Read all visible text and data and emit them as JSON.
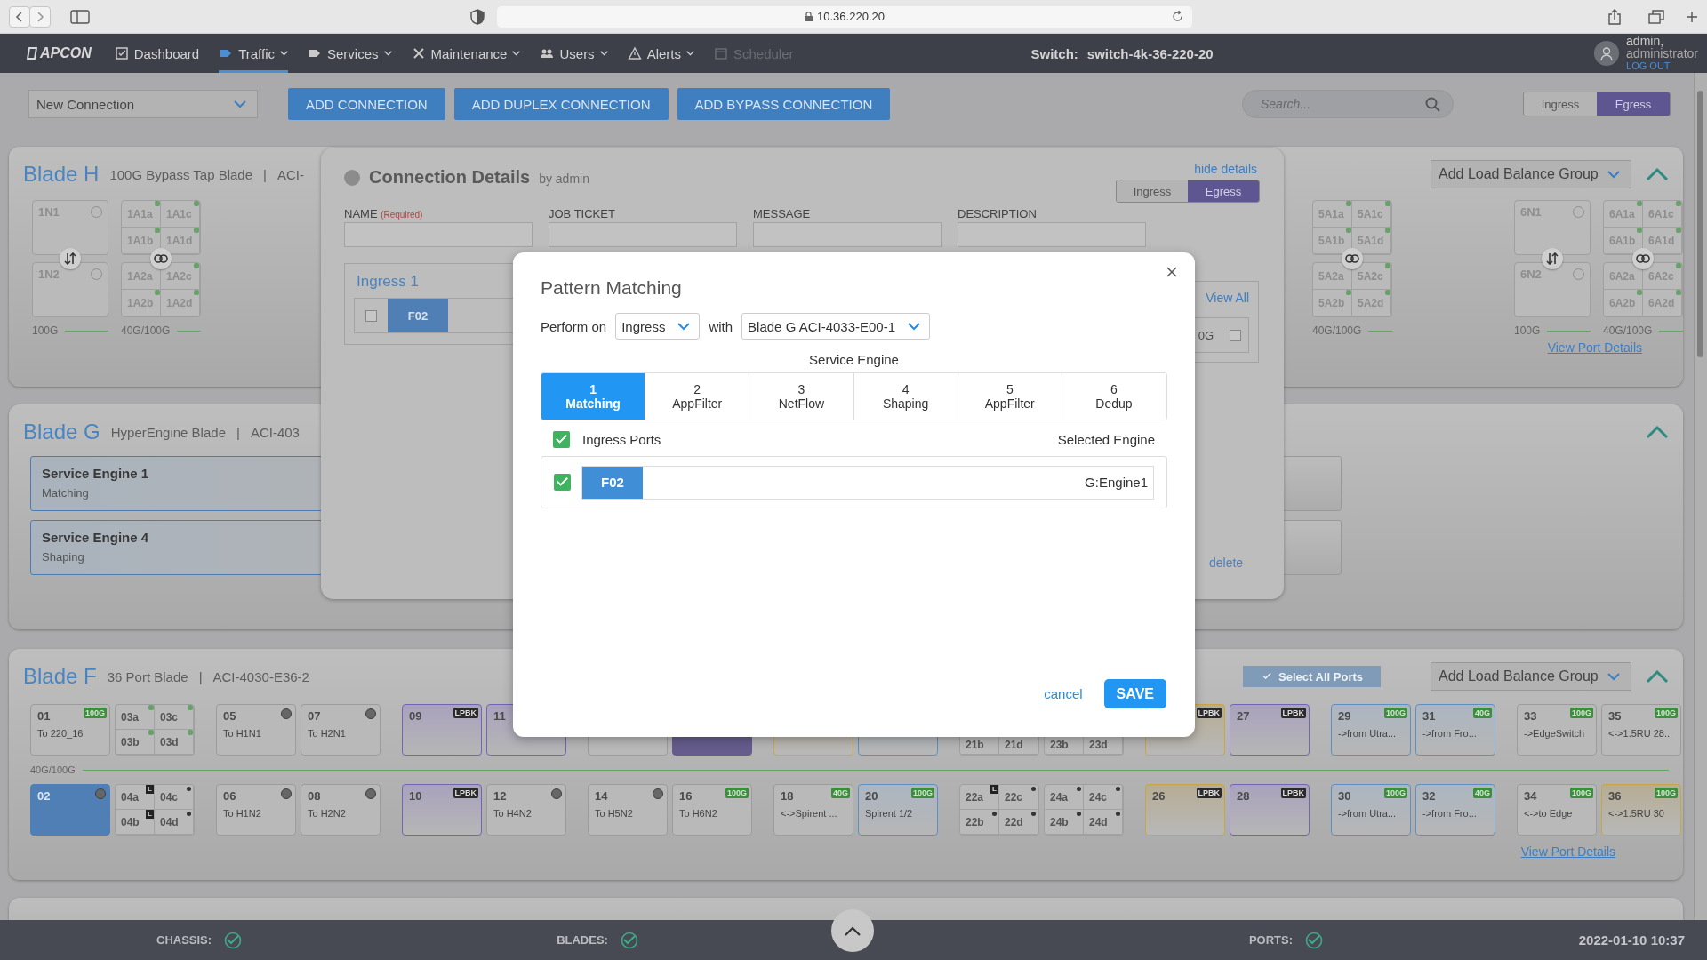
{
  "browser": {
    "url": "10.36.220.20"
  },
  "nav": {
    "logo": "APCON",
    "items": [
      {
        "label": "Dashboard",
        "selected": false,
        "disabled": false,
        "dropdown": false
      },
      {
        "label": "Traffic",
        "selected": true,
        "disabled": false,
        "dropdown": true
      },
      {
        "label": "Services",
        "selected": false,
        "disabled": false,
        "dropdown": true
      },
      {
        "label": "Maintenance",
        "selected": false,
        "disabled": false,
        "dropdown": true
      },
      {
        "label": "Users",
        "selected": false,
        "disabled": false,
        "dropdown": true
      },
      {
        "label": "Alerts",
        "selected": false,
        "disabled": false,
        "dropdown": true
      },
      {
        "label": "Scheduler",
        "selected": false,
        "disabled": true,
        "dropdown": false
      }
    ],
    "switch_label": "Switch:",
    "switch_name": "switch-4k-36-220-20",
    "user": {
      "name": "admin,",
      "role": "administrator",
      "logout": "LOG OUT"
    }
  },
  "toolbar": {
    "connection_select": "New Connection",
    "buttons": [
      "ADD CONNECTION",
      "ADD DUPLEX CONNECTION",
      "ADD BYPASS CONNECTION"
    ],
    "search": {
      "placeholder": "Search..."
    },
    "direction": [
      {
        "label": "Ingress",
        "selected": false
      },
      {
        "label": "Egress",
        "selected": true
      }
    ]
  },
  "blades": [
    {
      "kind": "tap",
      "title": "Blade H",
      "subtitle": "100G Bypass Tap Blade",
      "separator": "|",
      "model": "ACI-",
      "load_balance": "Add Load Balance Group",
      "expanded": true,
      "left_groups": [
        {
          "kind": "pair",
          "speed": "100G",
          "ports": [
            {
              "name": "1N1"
            },
            {
              "name": "1N2"
            }
          ]
        },
        {
          "kind": "quadstack",
          "speed": "40G/100G",
          "quads": [
            [
              {
                "name": "1A1a",
                "kind": "active"
              },
              {
                "name": "1A1c",
                "kind": "active"
              },
              {
                "name": "1A1b",
                "kind": "active"
              },
              {
                "name": "1A1d",
                "kind": "active"
              }
            ],
            [
              {
                "name": "1A2a",
                "kind": "active"
              },
              {
                "name": "1A2c",
                "kind": "active"
              },
              {
                "name": "1A2b",
                "kind": "active"
              },
              {
                "name": "1A2d",
                "kind": "active"
              }
            ]
          ]
        }
      ],
      "right_groups": [
        {
          "kind": "quadstack",
          "speed": "40G/100G",
          "quads": [
            [
              {
                "name": "5A1a",
                "kind": "active"
              },
              {
                "name": "5A1c",
                "kind": "active"
              },
              {
                "name": "5A1b",
                "kind": "active"
              },
              {
                "name": "5A1d",
                "kind": "active"
              }
            ],
            [
              {
                "name": "5A2a",
                "kind": "active"
              },
              {
                "name": "5A2c",
                "kind": "active"
              },
              {
                "name": "5A2b",
                "kind": "active"
              },
              {
                "name": "5A2d",
                "kind": "active"
              }
            ]
          ]
        },
        {
          "kind": "pair",
          "speed": "100G",
          "ports": [
            {
              "name": "6N1"
            },
            {
              "name": "6N2"
            }
          ]
        },
        {
          "kind": "quadstack",
          "speed": "40G/100G",
          "quads": [
            [
              {
                "name": "6A1a",
                "kind": "active"
              },
              {
                "name": "6A1c",
                "kind": "active"
              },
              {
                "name": "6A1b",
                "kind": "active"
              },
              {
                "name": "6A1d",
                "kind": "active"
              }
            ],
            [
              {
                "name": "6A2a",
                "kind": "active"
              },
              {
                "name": "6A2c",
                "kind": "active"
              },
              {
                "name": "6A2b",
                "kind": "active"
              },
              {
                "name": "6A2d",
                "kind": "active"
              }
            ]
          ]
        }
      ],
      "link": "View Port Details"
    },
    {
      "kind": "engines",
      "title": "Blade G",
      "subtitle": "HyperEngine Blade",
      "separator": "|",
      "model": "ACI-403",
      "expanded": true,
      "engines": [
        {
          "name": "Service Engine 1",
          "function": "Matching"
        },
        {
          "name": "Service Engine 4",
          "function": "Shaping"
        }
      ]
    },
    {
      "kind": "ports",
      "title": "Blade F",
      "subtitle": "36 Port Blade",
      "separator": "|",
      "model": "ACI-4030-E36-2",
      "select_all": "Select All Ports",
      "load_balance": "Add Load Balance Group",
      "expanded": true,
      "speed": "40G/100G",
      "top_row": [
        [
          {
            "kind": "plain",
            "num": "01",
            "label": "To 220_16",
            "badge": {
              "text": "100G",
              "kind": "speed"
            },
            "led": false,
            "selected": false
          },
          {
            "kind": "quad",
            "subports": [
              {
                "name": "03a",
                "kind": "active"
              },
              {
                "name": "03c",
                "kind": "active"
              },
              {
                "name": "03b",
                "kind": "active"
              },
              {
                "name": "03d",
                "kind": "active"
              }
            ]
          }
        ],
        [
          {
            "kind": "plain",
            "num": "05",
            "label": "To H1N1",
            "led": true,
            "selected": false
          },
          {
            "kind": "plain",
            "num": "07",
            "label": "To H2N1",
            "led": true,
            "selected": false
          }
        ],
        [
          {
            "kind": "loopback",
            "num": "09",
            "badge": {
              "text": "LPBK",
              "kind": "loop"
            },
            "led": false,
            "selected": false
          },
          {
            "kind": "loopback",
            "num": "11",
            "led": false,
            "selected": false
          }
        ],
        [
          {
            "kind": "plain",
            "led": false,
            "selected": false
          },
          {
            "kind": "filled",
            "led": false,
            "selected": false
          }
        ],
        [
          {
            "kind": "warning",
            "led": false,
            "selected": false
          },
          {
            "kind": "linked",
            "led": false,
            "selected": false
          }
        ],
        [
          {
            "kind": "quad",
            "subports": [
              {
                "name": "21b",
                "kind": "plain"
              },
              {
                "name": "21d",
                "kind": "plain"
              }
            ]
          },
          {
            "kind": "quad",
            "subports": [
              {
                "name": "23b",
                "kind": "plain"
              },
              {
                "name": "23d",
                "kind": "plain"
              }
            ]
          }
        ],
        [
          {
            "kind": "warning",
            "badge": {
              "text": "LPBK",
              "kind": "loop"
            },
            "led": false,
            "selected": false
          },
          {
            "kind": "loopback",
            "num": "27",
            "badge": {
              "text": "LPBK",
              "kind": "loop"
            },
            "led": false,
            "selected": false
          }
        ],
        [
          {
            "kind": "linked",
            "num": "29",
            "label": "->from Utra...",
            "badge": {
              "text": "100G",
              "kind": "speed"
            },
            "led": false,
            "selected": false
          },
          {
            "kind": "linked",
            "num": "31",
            "label": "->from Fro...",
            "badge": {
              "text": "40G",
              "kind": "speed"
            },
            "led": false,
            "selected": false
          }
        ],
        [
          {
            "kind": "plain",
            "num": "33",
            "label": "->EdgeSwitch",
            "badge": {
              "text": "100G",
              "kind": "speed"
            },
            "led": false,
            "selected": false
          },
          {
            "kind": "plain",
            "num": "35",
            "label": "<->1.5RU 28...",
            "badge": {
              "text": "100G",
              "kind": "speed"
            },
            "led": false,
            "selected": false
          }
        ]
      ],
      "bottom_row": [
        [
          {
            "kind": "plain",
            "num": "02",
            "led": true,
            "selected": true
          },
          {
            "kind": "quad",
            "subports": [
              {
                "name": "04a",
                "kind": "letter",
                "mark_text": "L"
              },
              {
                "name": "04c",
                "kind": "dot"
              },
              {
                "name": "04b",
                "kind": "letter",
                "mark_text": "L"
              },
              {
                "name": "04d",
                "kind": "dot"
              }
            ]
          }
        ],
        [
          {
            "kind": "plain",
            "num": "06",
            "label": "To H1N2",
            "led": true,
            "selected": false
          },
          {
            "kind": "plain",
            "num": "08",
            "label": "To H2N2",
            "led": true,
            "selected": false
          }
        ],
        [
          {
            "kind": "loopback",
            "num": "10",
            "badge": {
              "text": "LPBK",
              "kind": "loop"
            },
            "led": false,
            "selected": false
          },
          {
            "kind": "plain",
            "num": "12",
            "label": "To H4N2",
            "led": true,
            "selected": false
          }
        ],
        [
          {
            "kind": "plain",
            "num": "14",
            "label": "To H5N2",
            "led": true,
            "selected": false
          },
          {
            "kind": "plain",
            "num": "16",
            "label": "To H6N2",
            "badge": {
              "text": "100G",
              "kind": "speed"
            },
            "led": false,
            "selected": false
          }
        ],
        [
          {
            "kind": "plain",
            "num": "18",
            "label": "<->Spirent ...",
            "badge": {
              "text": "40G",
              "kind": "speed"
            },
            "led": false,
            "selected": false
          },
          {
            "kind": "linked",
            "num": "20",
            "label": "Spirent 1/2",
            "badge": {
              "text": "100G",
              "kind": "speed"
            },
            "led": false,
            "selected": false
          }
        ],
        [
          {
            "kind": "quad",
            "subports": [
              {
                "name": "22a",
                "kind": "letter",
                "mark_text": "L"
              },
              {
                "name": "22c",
                "kind": "dot"
              },
              {
                "name": "22b",
                "kind": "dot"
              },
              {
                "name": "22d",
                "kind": "dot"
              }
            ]
          },
          {
            "kind": "quad",
            "subports": [
              {
                "name": "24a",
                "kind": "dot"
              },
              {
                "name": "24c",
                "kind": "dot"
              },
              {
                "name": "24b",
                "kind": "dot"
              },
              {
                "name": "24d",
                "kind": "dot"
              }
            ]
          }
        ],
        [
          {
            "kind": "warning",
            "num": "26",
            "badge": {
              "text": "LPBK",
              "kind": "loop"
            },
            "led": false,
            "selected": false
          },
          {
            "kind": "loopback",
            "num": "28",
            "badge": {
              "text": "LPBK",
              "kind": "loop"
            },
            "led": false,
            "selected": false
          }
        ],
        [
          {
            "kind": "linked",
            "num": "30",
            "label": "->from Utra...",
            "badge": {
              "text": "100G",
              "kind": "speed"
            },
            "led": false,
            "selected": false
          },
          {
            "kind": "linked",
            "num": "32",
            "label": "->from Fro...",
            "badge": {
              "text": "40G",
              "kind": "speed"
            },
            "led": false,
            "selected": false
          }
        ],
        [
          {
            "kind": "plain",
            "num": "34",
            "label": "<->to Edge",
            "badge": {
              "text": "100G",
              "kind": "speed"
            },
            "led": false,
            "selected": false
          },
          {
            "kind": "warning",
            "num": "36",
            "label": "<->1.5RU 30",
            "badge": {
              "text": "100G",
              "kind": "speed"
            },
            "led": false,
            "selected": false
          }
        ]
      ],
      "link": "View Port Details"
    },
    {
      "kind": "stub"
    }
  ],
  "connection_details": {
    "title": "Connection Details",
    "by": "by admin",
    "hide": "hide details",
    "direction": [
      {
        "label": "Ingress",
        "selected": false
      },
      {
        "label": "Egress",
        "selected": true
      }
    ],
    "fields": [
      {
        "label": "NAME",
        "required": "(Required)"
      },
      {
        "label": "JOB TICKET"
      },
      {
        "label": "MESSAGE"
      },
      {
        "label": "DESCRIPTION"
      }
    ],
    "ingress": {
      "title": "Ingress 1",
      "ports": [
        {
          "name": "F02",
          "checked": false
        }
      ]
    },
    "egress": {
      "view_all": "View All",
      "port_fragment": "0G",
      "checked": false
    },
    "delete": "delete"
  },
  "pattern_matching": {
    "title": "Pattern Matching",
    "perform_label": "Perform on",
    "perform_value": "Ingress",
    "with_label": "with",
    "with_value": "Blade G ACI-4033-E00-1",
    "engine_heading": "Service Engine",
    "tabs": [
      {
        "number": "1",
        "label": "Matching",
        "selected": true
      },
      {
        "number": "2",
        "label": "AppFilter",
        "selected": false
      },
      {
        "number": "3",
        "label": "NetFlow",
        "selected": false
      },
      {
        "number": "4",
        "label": "Shaping",
        "selected": false
      },
      {
        "number": "5",
        "label": "AppFilter",
        "selected": false
      },
      {
        "number": "6",
        "label": "Dedup",
        "selected": false
      }
    ],
    "ports_header": {
      "label": "Ingress Ports",
      "checked": true,
      "engine_heading": "Selected Engine"
    },
    "ports": [
      {
        "name": "F02",
        "engine": "G:Engine1",
        "checked": true
      }
    ],
    "cancel": "cancel",
    "save": "SAVE"
  },
  "status_bar": {
    "items": [
      {
        "label": "CHASSIS:",
        "ok": true
      },
      {
        "label": "BLADES:",
        "ok": true
      },
      {
        "label": "PORTS:",
        "ok": true
      }
    ],
    "timestamp": "2022-01-10 10:37"
  }
}
